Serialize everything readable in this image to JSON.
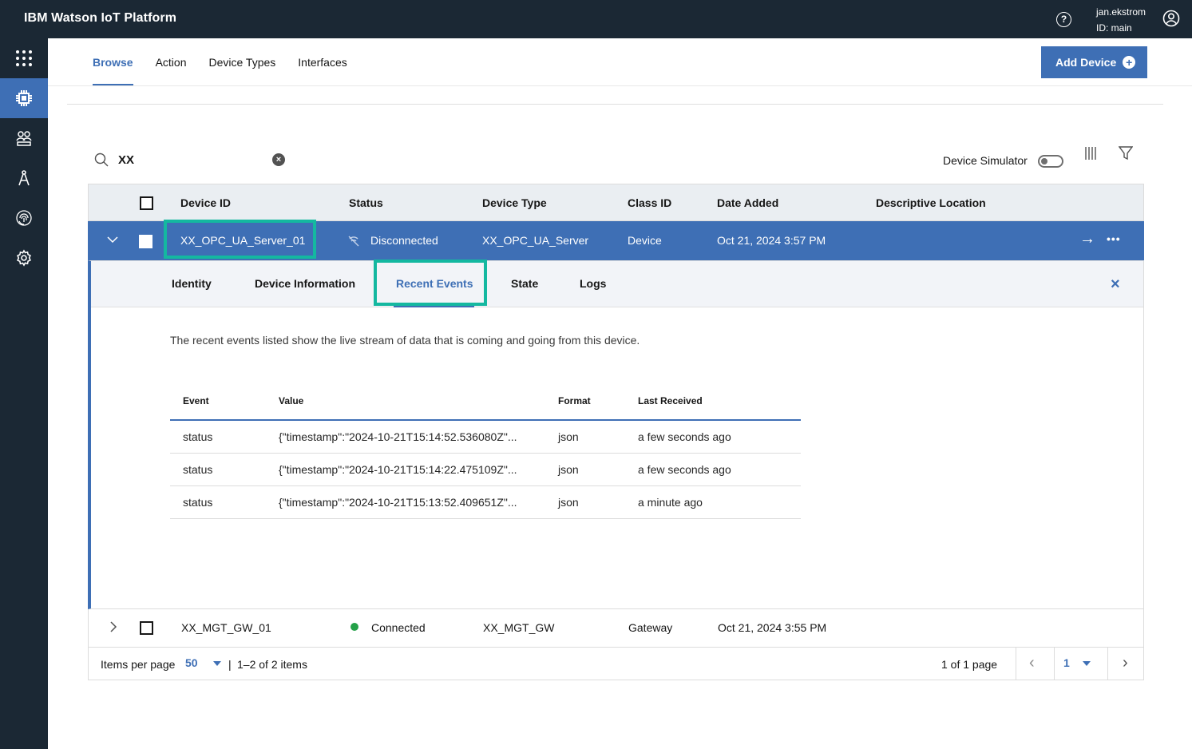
{
  "app": {
    "title": "IBM Watson IoT Platform",
    "help_glyph": "?",
    "user_name": "jan.ekstrom",
    "user_id": "ID: main"
  },
  "sidebar": {
    "items": [
      {
        "icon": "apps-grid-icon",
        "active": false
      },
      {
        "icon": "chip-devices-icon",
        "active": true
      },
      {
        "icon": "members-icon",
        "active": false
      },
      {
        "icon": "compass-apps-icon",
        "active": false
      },
      {
        "icon": "fingerprint-security-icon",
        "active": false
      },
      {
        "icon": "gear-settings-icon",
        "active": false
      }
    ]
  },
  "nav": {
    "tabs": [
      "Browse",
      "Action",
      "Device Types",
      "Interfaces"
    ],
    "active_tab": "Browse",
    "add_device_label": "Add Device",
    "add_device_glyph": "+"
  },
  "search": {
    "value": "XX",
    "clear_glyph": "×",
    "device_simulator_label": "Device Simulator",
    "simulator_on": false
  },
  "table": {
    "headers": [
      "Device ID",
      "Status",
      "Device Type",
      "Class ID",
      "Date Added",
      "Descriptive Location"
    ],
    "rows": [
      {
        "device_id": "XX_OPC_UA_Server_01",
        "status": "Disconnected",
        "device_type": "XX_OPC_UA_Server",
        "class_id": "Device",
        "date_added": "Oct 21, 2024 3:57 PM",
        "expanded": true,
        "selected_row": true
      },
      {
        "device_id": "XX_MGT_GW_01",
        "status": "Connected",
        "device_type": "XX_MGT_GW",
        "class_id": "Gateway",
        "date_added": "Oct 21, 2024 3:55 PM",
        "expanded": false,
        "selected_row": false
      }
    ],
    "row_arrow_glyph": "→",
    "row_menu_glyph": "•••"
  },
  "detail": {
    "tabs": [
      "Identity",
      "Device Information",
      "Recent Events",
      "State",
      "Logs"
    ],
    "active_tab": "Recent Events",
    "close_glyph": "×",
    "description": "The recent events listed show the live stream of data that is coming and going from this device.",
    "events_headers": [
      "Event",
      "Value",
      "Format",
      "Last Received"
    ],
    "events": [
      {
        "event": "status",
        "value": "{\"timestamp\":\"2024-10-21T15:14:52.536080Z\"...",
        "format": "json",
        "last_received": "a few seconds ago"
      },
      {
        "event": "status",
        "value": "{\"timestamp\":\"2024-10-21T15:14:22.475109Z\"...",
        "format": "json",
        "last_received": "a few seconds ago"
      },
      {
        "event": "status",
        "value": "{\"timestamp\":\"2024-10-21T15:13:52.409651Z\"...",
        "format": "json",
        "last_received": "a minute ago"
      }
    ]
  },
  "pagination": {
    "items_per_page_label": "Items per page",
    "items_per_page": "50",
    "range_text": "1–2 of 2 items",
    "page_info": "1 of 1 page",
    "current_page": "1",
    "prev_glyph": "‹",
    "next_glyph": "›"
  },
  "colors": {
    "header_bg": "#1b2834",
    "accent": "#3e6fb5",
    "highlight": "#14b8a0",
    "connected": "#24a148"
  }
}
